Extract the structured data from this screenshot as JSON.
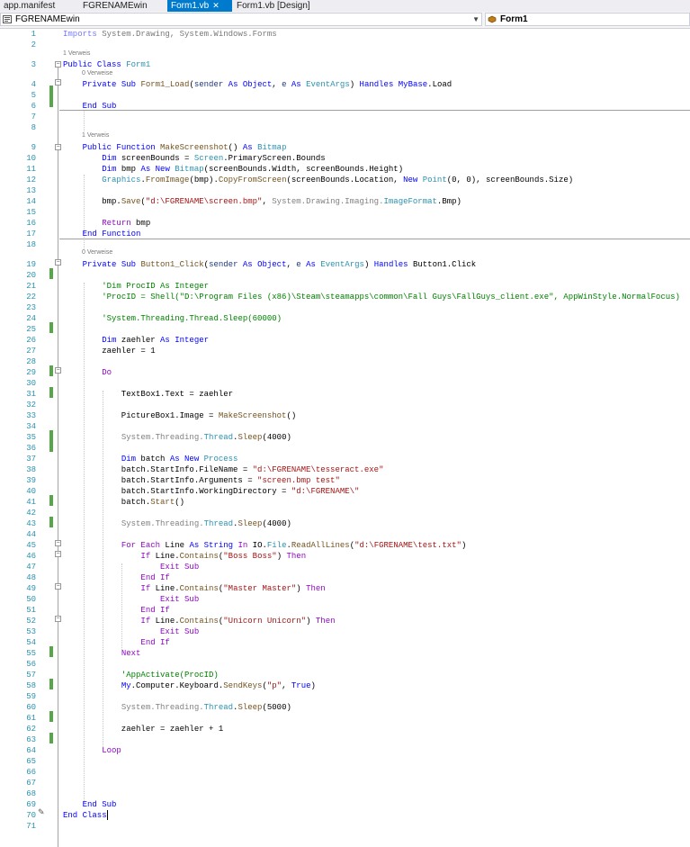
{
  "tabs": [
    {
      "label": "app.manifest"
    },
    {
      "label": "FGRENAMEwin"
    },
    {
      "label": "Form1.vb",
      "active": true
    },
    {
      "label": "Form1.vb [Design]"
    }
  ],
  "navbar": {
    "project": "FGRENAMEwin",
    "member": "Form1"
  },
  "colors": {
    "accent": "#007acc",
    "line_number": "#2b91af",
    "keyword": "#0000ff",
    "type": "#2b91af",
    "string": "#a31515",
    "comment": "#008000",
    "change_marker": "#57a64a"
  },
  "code_lens": {
    "l3": "1 Verweis",
    "l4": "0 Verweise",
    "l9": "1 Verweis",
    "l19": "0 Verweise"
  },
  "lines": [
    {
      "n": "1",
      "tokens": [
        [
          "k",
          "Imports"
        ],
        [
          "n",
          " System.Drawing, System.Windows.Forms"
        ]
      ],
      "gray": true
    },
    {
      "n": "2",
      "tokens": []
    },
    {
      "n": "3",
      "tokens": [
        [
          "k",
          "Public"
        ],
        [
          "n",
          " "
        ],
        [
          "k",
          "Class"
        ],
        [
          "n",
          " "
        ],
        [
          "t",
          "Form1"
        ]
      ]
    },
    {
      "n": "4",
      "tokens": [
        [
          "n",
          "    "
        ],
        [
          "k",
          "Private Sub"
        ],
        [
          "n",
          " "
        ],
        [
          "m",
          "Form1_Load"
        ],
        [
          "n",
          "("
        ],
        [
          "p",
          "sender"
        ],
        [
          "n",
          " "
        ],
        [
          "k",
          "As Object"
        ],
        [
          "n",
          ", "
        ],
        [
          "p",
          "e"
        ],
        [
          "n",
          " "
        ],
        [
          "k",
          "As"
        ],
        [
          "n",
          " "
        ],
        [
          "t",
          "EventArgs"
        ],
        [
          "n",
          ") "
        ],
        [
          "k",
          "Handles"
        ],
        [
          "n",
          " "
        ],
        [
          "k",
          "MyBase"
        ],
        [
          "n",
          ".Load"
        ]
      ]
    },
    {
      "n": "5",
      "tokens": []
    },
    {
      "n": "6",
      "tokens": [
        [
          "n",
          "    "
        ],
        [
          "k",
          "End Sub"
        ]
      ]
    },
    {
      "n": "7",
      "tokens": []
    },
    {
      "n": "8",
      "tokens": []
    },
    {
      "n": "9",
      "tokens": [
        [
          "n",
          "    "
        ],
        [
          "k",
          "Public Function"
        ],
        [
          "n",
          " "
        ],
        [
          "m",
          "MakeScreenshot"
        ],
        [
          "n",
          "() "
        ],
        [
          "k",
          "As"
        ],
        [
          "n",
          " "
        ],
        [
          "t",
          "Bitmap"
        ]
      ]
    },
    {
      "n": "10",
      "tokens": [
        [
          "n",
          "        "
        ],
        [
          "k",
          "Dim"
        ],
        [
          "n",
          " screenBounds = "
        ],
        [
          "t",
          "Screen"
        ],
        [
          "n",
          ".PrimaryScreen.Bounds"
        ]
      ]
    },
    {
      "n": "11",
      "tokens": [
        [
          "n",
          "        "
        ],
        [
          "k",
          "Dim"
        ],
        [
          "n",
          " bmp "
        ],
        [
          "k",
          "As New"
        ],
        [
          "n",
          " "
        ],
        [
          "t",
          "Bitmap"
        ],
        [
          "n",
          "(screenBounds.Width, screenBounds.Height)"
        ]
      ]
    },
    {
      "n": "12",
      "tokens": [
        [
          "n",
          "        "
        ],
        [
          "t",
          "Graphics"
        ],
        [
          "n",
          "."
        ],
        [
          "m",
          "FromImage"
        ],
        [
          "n",
          "(bmp)."
        ],
        [
          "m",
          "CopyFromScreen"
        ],
        [
          "n",
          "(screenBounds.Location, "
        ],
        [
          "k",
          "New"
        ],
        [
          "n",
          " "
        ],
        [
          "t",
          "Point"
        ],
        [
          "n",
          "(0, 0), screenBounds.Size)"
        ]
      ]
    },
    {
      "n": "13",
      "tokens": []
    },
    {
      "n": "14",
      "tokens": [
        [
          "n",
          "        bmp."
        ],
        [
          "m",
          "Save"
        ],
        [
          "n",
          "("
        ],
        [
          "s",
          "\"d:\\FGRENAME\\screen.bmp\""
        ],
        [
          "n",
          ", "
        ],
        [
          "gray",
          "System.Drawing.Imaging."
        ],
        [
          "t",
          "ImageFormat"
        ],
        [
          "n",
          ".Bmp)"
        ]
      ]
    },
    {
      "n": "15",
      "tokens": []
    },
    {
      "n": "16",
      "tokens": [
        [
          "n",
          "        "
        ],
        [
          "kc",
          "Return"
        ],
        [
          "n",
          " bmp"
        ]
      ]
    },
    {
      "n": "17",
      "tokens": [
        [
          "n",
          "    "
        ],
        [
          "k",
          "End Function"
        ]
      ]
    },
    {
      "n": "18",
      "tokens": []
    },
    {
      "n": "19",
      "tokens": [
        [
          "n",
          "    "
        ],
        [
          "k",
          "Private Sub"
        ],
        [
          "n",
          " "
        ],
        [
          "m",
          "Button1_Click"
        ],
        [
          "n",
          "("
        ],
        [
          "p",
          "sender"
        ],
        [
          "n",
          " "
        ],
        [
          "k",
          "As Object"
        ],
        [
          "n",
          ", "
        ],
        [
          "p",
          "e"
        ],
        [
          "n",
          " "
        ],
        [
          "k",
          "As"
        ],
        [
          "n",
          " "
        ],
        [
          "t",
          "EventArgs"
        ],
        [
          "n",
          ") "
        ],
        [
          "k",
          "Handles"
        ],
        [
          "n",
          " Button1.Click"
        ]
      ]
    },
    {
      "n": "20",
      "tokens": []
    },
    {
      "n": "21",
      "tokens": [
        [
          "n",
          "        "
        ],
        [
          "c",
          "'Dim ProcID As Integer"
        ]
      ]
    },
    {
      "n": "22",
      "tokens": [
        [
          "n",
          "        "
        ],
        [
          "c",
          "'ProcID = Shell(\"D:\\Program Files (x86)\\Steam\\steamapps\\common\\Fall Guys\\FallGuys_client.exe\", AppWinStyle.NormalFocus)"
        ]
      ]
    },
    {
      "n": "23",
      "tokens": []
    },
    {
      "n": "24",
      "tokens": [
        [
          "n",
          "        "
        ],
        [
          "c",
          "'System.Threading.Thread.Sleep(60000)"
        ]
      ]
    },
    {
      "n": "25",
      "tokens": []
    },
    {
      "n": "26",
      "tokens": [
        [
          "n",
          "        "
        ],
        [
          "k",
          "Dim"
        ],
        [
          "n",
          " zaehler "
        ],
        [
          "k",
          "As Integer"
        ]
      ]
    },
    {
      "n": "27",
      "tokens": [
        [
          "n",
          "        zaehler = 1"
        ]
      ]
    },
    {
      "n": "28",
      "tokens": []
    },
    {
      "n": "29",
      "tokens": [
        [
          "n",
          "        "
        ],
        [
          "kc",
          "Do"
        ]
      ]
    },
    {
      "n": "30",
      "tokens": []
    },
    {
      "n": "31",
      "tokens": [
        [
          "n",
          "            TextBox1.Text = zaehler"
        ]
      ]
    },
    {
      "n": "32",
      "tokens": []
    },
    {
      "n": "33",
      "tokens": [
        [
          "n",
          "            PictureBox1.Image = "
        ],
        [
          "m",
          "MakeScreenshot"
        ],
        [
          "n",
          "()"
        ]
      ]
    },
    {
      "n": "34",
      "tokens": []
    },
    {
      "n": "35",
      "tokens": [
        [
          "n",
          "            "
        ],
        [
          "gray",
          "System.Threading."
        ],
        [
          "t",
          "Thread"
        ],
        [
          "n",
          "."
        ],
        [
          "m",
          "Sleep"
        ],
        [
          "n",
          "(4000)"
        ]
      ]
    },
    {
      "n": "36",
      "tokens": []
    },
    {
      "n": "37",
      "tokens": [
        [
          "n",
          "            "
        ],
        [
          "k",
          "Dim"
        ],
        [
          "n",
          " batch "
        ],
        [
          "k",
          "As New"
        ],
        [
          "n",
          " "
        ],
        [
          "t",
          "Process"
        ]
      ]
    },
    {
      "n": "38",
      "tokens": [
        [
          "n",
          "            batch.StartInfo.FileName = "
        ],
        [
          "s",
          "\"d:\\FGRENAME\\tesseract.exe\""
        ]
      ]
    },
    {
      "n": "39",
      "tokens": [
        [
          "n",
          "            batch.StartInfo.Arguments = "
        ],
        [
          "s",
          "\"screen.bmp test\""
        ]
      ]
    },
    {
      "n": "40",
      "tokens": [
        [
          "n",
          "            batch.StartInfo.WorkingDirectory = "
        ],
        [
          "s",
          "\"d:\\FGRENAME\\\""
        ]
      ]
    },
    {
      "n": "41",
      "tokens": [
        [
          "n",
          "            batch."
        ],
        [
          "m",
          "Start"
        ],
        [
          "n",
          "()"
        ]
      ]
    },
    {
      "n": "42",
      "tokens": []
    },
    {
      "n": "43",
      "tokens": [
        [
          "n",
          "            "
        ],
        [
          "gray",
          "System.Threading."
        ],
        [
          "t",
          "Thread"
        ],
        [
          "n",
          "."
        ],
        [
          "m",
          "Sleep"
        ],
        [
          "n",
          "(4000)"
        ]
      ]
    },
    {
      "n": "44",
      "tokens": []
    },
    {
      "n": "45",
      "tokens": [
        [
          "n",
          "            "
        ],
        [
          "kc",
          "For Each"
        ],
        [
          "n",
          " Line "
        ],
        [
          "k",
          "As String"
        ],
        [
          "n",
          " "
        ],
        [
          "kc",
          "In"
        ],
        [
          "n",
          " IO."
        ],
        [
          "t",
          "File"
        ],
        [
          "n",
          "."
        ],
        [
          "m",
          "ReadAllLines"
        ],
        [
          "n",
          "("
        ],
        [
          "s",
          "\"d:\\FGRENAME\\test.txt\""
        ],
        [
          "n",
          ")"
        ]
      ]
    },
    {
      "n": "46",
      "tokens": [
        [
          "n",
          "                "
        ],
        [
          "kc",
          "If"
        ],
        [
          "n",
          " Line."
        ],
        [
          "m",
          "Contains"
        ],
        [
          "n",
          "("
        ],
        [
          "s",
          "\"Boss Boss\""
        ],
        [
          "n",
          ") "
        ],
        [
          "kc",
          "Then"
        ]
      ]
    },
    {
      "n": "47",
      "tokens": [
        [
          "n",
          "                    "
        ],
        [
          "kc",
          "Exit Sub"
        ]
      ]
    },
    {
      "n": "48",
      "tokens": [
        [
          "n",
          "                "
        ],
        [
          "kc",
          "End If"
        ]
      ]
    },
    {
      "n": "49",
      "tokens": [
        [
          "n",
          "                "
        ],
        [
          "kc",
          "If"
        ],
        [
          "n",
          " Line."
        ],
        [
          "m",
          "Contains"
        ],
        [
          "n",
          "("
        ],
        [
          "s",
          "\"Master Master\""
        ],
        [
          "n",
          ") "
        ],
        [
          "kc",
          "Then"
        ]
      ]
    },
    {
      "n": "50",
      "tokens": [
        [
          "n",
          "                    "
        ],
        [
          "kc",
          "Exit Sub"
        ]
      ]
    },
    {
      "n": "51",
      "tokens": [
        [
          "n",
          "                "
        ],
        [
          "kc",
          "End If"
        ]
      ]
    },
    {
      "n": "52",
      "tokens": [
        [
          "n",
          "                "
        ],
        [
          "kc",
          "If"
        ],
        [
          "n",
          " Line."
        ],
        [
          "m",
          "Contains"
        ],
        [
          "n",
          "("
        ],
        [
          "s",
          "\"Unicorn Unicorn\""
        ],
        [
          "n",
          ") "
        ],
        [
          "kc",
          "Then"
        ]
      ]
    },
    {
      "n": "53",
      "tokens": [
        [
          "n",
          "                    "
        ],
        [
          "kc",
          "Exit Sub"
        ]
      ]
    },
    {
      "n": "54",
      "tokens": [
        [
          "n",
          "                "
        ],
        [
          "kc",
          "End If"
        ]
      ]
    },
    {
      "n": "55",
      "tokens": [
        [
          "n",
          "            "
        ],
        [
          "kc",
          "Next"
        ]
      ]
    },
    {
      "n": "56",
      "tokens": []
    },
    {
      "n": "57",
      "tokens": [
        [
          "n",
          "            "
        ],
        [
          "c",
          "'AppActivate(ProcID)"
        ]
      ]
    },
    {
      "n": "58",
      "tokens": [
        [
          "n",
          "            "
        ],
        [
          "k",
          "My"
        ],
        [
          "n",
          ".Computer.Keyboard."
        ],
        [
          "m",
          "SendKeys"
        ],
        [
          "n",
          "("
        ],
        [
          "s",
          "\"p\""
        ],
        [
          "n",
          ", "
        ],
        [
          "k",
          "True"
        ],
        [
          "n",
          ")"
        ]
      ]
    },
    {
      "n": "59",
      "tokens": []
    },
    {
      "n": "60",
      "tokens": [
        [
          "n",
          "            "
        ],
        [
          "gray",
          "System.Threading."
        ],
        [
          "t",
          "Thread"
        ],
        [
          "n",
          "."
        ],
        [
          "m",
          "Sleep"
        ],
        [
          "n",
          "(5000)"
        ]
      ]
    },
    {
      "n": "61",
      "tokens": []
    },
    {
      "n": "62",
      "tokens": [
        [
          "n",
          "            zaehler = zaehler + 1"
        ]
      ]
    },
    {
      "n": "63",
      "tokens": []
    },
    {
      "n": "64",
      "tokens": [
        [
          "n",
          "        "
        ],
        [
          "kc",
          "Loop"
        ]
      ]
    },
    {
      "n": "65",
      "tokens": []
    },
    {
      "n": "66",
      "tokens": []
    },
    {
      "n": "67",
      "tokens": []
    },
    {
      "n": "68",
      "tokens": []
    },
    {
      "n": "69",
      "tokens": [
        [
          "n",
          "    "
        ],
        [
          "k",
          "End Sub"
        ]
      ]
    },
    {
      "n": "70",
      "tokens": [
        [
          "k",
          "End Class"
        ]
      ]
    },
    {
      "n": "71",
      "tokens": []
    }
  ]
}
